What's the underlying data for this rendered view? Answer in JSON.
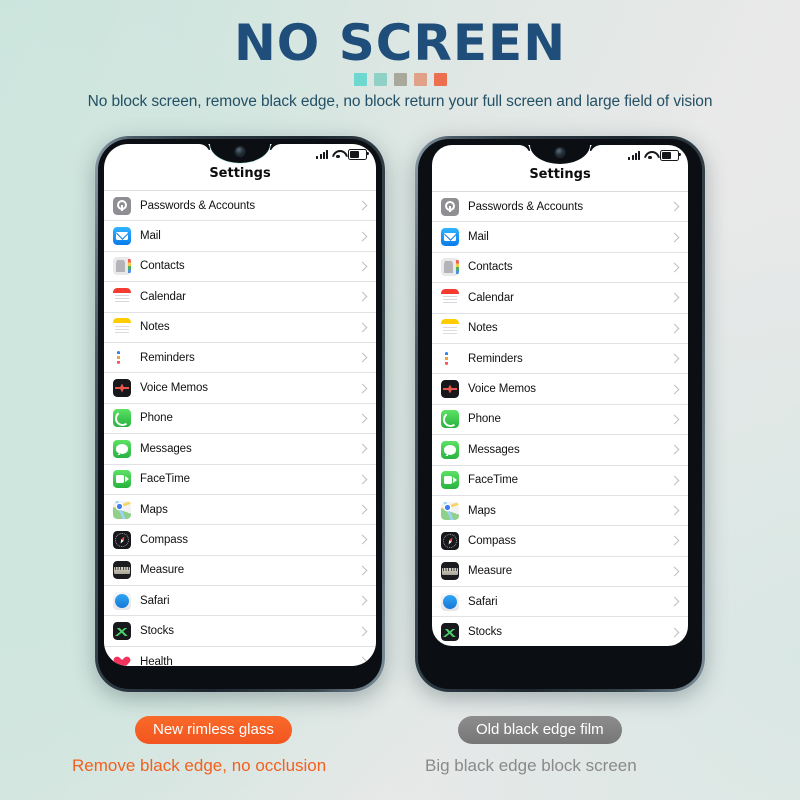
{
  "header": {
    "headline": "NO SCREEN",
    "subtitle": "No block screen, remove black edge, no block return your full screen and large field of vision",
    "headline_color": "#1e4e79",
    "subtitle_color": "#245066",
    "dots": [
      {
        "name": "dot-1",
        "color": "#6ed7cf"
      },
      {
        "name": "dot-2",
        "color": "#8fd1c4"
      },
      {
        "name": "dot-3",
        "color": "#a8a99b"
      },
      {
        "name": "dot-4",
        "color": "#e2a088"
      },
      {
        "name": "dot-5",
        "color": "#ec7050"
      }
    ]
  },
  "phones": [
    {
      "id": "left",
      "variant": "rimless",
      "statusbar": {
        "signal_icon": "signal-bars-icon",
        "wifi_icon": "wifi-icon",
        "battery_icon": "battery-icon"
      },
      "title": "Settings",
      "notch": "water-drop-notch",
      "camera": "front-camera"
    },
    {
      "id": "right",
      "variant": "black-edge",
      "statusbar": {
        "signal_icon": "signal-bars-icon",
        "wifi_icon": "wifi-icon",
        "battery_icon": "battery-icon"
      },
      "title": "Settings",
      "notch": "water-drop-notch",
      "camera": "front-camera"
    }
  ],
  "settings_list": [
    {
      "label": "Passwords & Accounts",
      "icon": "passwords-icon",
      "icon_class": "ic-passwords"
    },
    {
      "label": "Mail",
      "icon": "mail-icon",
      "icon_class": "ic-mail"
    },
    {
      "label": "Contacts",
      "icon": "contacts-icon",
      "icon_class": "ic-contacts"
    },
    {
      "label": "Calendar",
      "icon": "calendar-icon",
      "icon_class": "ic-calendar"
    },
    {
      "label": "Notes",
      "icon": "notes-icon",
      "icon_class": "ic-notes"
    },
    {
      "label": "Reminders",
      "icon": "reminders-icon",
      "icon_class": "ic-reminders"
    },
    {
      "label": "Voice Memos",
      "icon": "voice-memos-icon",
      "icon_class": "ic-voicememos"
    },
    {
      "label": "Phone",
      "icon": "phone-icon",
      "icon_class": "ic-phone"
    },
    {
      "label": "Messages",
      "icon": "messages-icon",
      "icon_class": "ic-messages"
    },
    {
      "label": "FaceTime",
      "icon": "facetime-icon",
      "icon_class": "ic-facetime"
    },
    {
      "label": "Maps",
      "icon": "maps-icon",
      "icon_class": "ic-maps"
    },
    {
      "label": "Compass",
      "icon": "compass-icon",
      "icon_class": "ic-compass"
    },
    {
      "label": "Measure",
      "icon": "measure-icon",
      "icon_class": "ic-measure"
    },
    {
      "label": "Safari",
      "icon": "safari-icon",
      "icon_class": "ic-safari"
    },
    {
      "label": "Stocks",
      "icon": "stocks-icon",
      "icon_class": "ic-stocks"
    },
    {
      "label": "Health",
      "icon": "health-icon",
      "icon_class": "ic-health"
    }
  ],
  "footer": {
    "new_badge": "New rimless glass",
    "new_caption": "Remove black edge, no occlusion",
    "old_badge": "Old black edge film",
    "old_caption": "Big black edge block screen",
    "new_color": "#f2601f",
    "old_color": "#8a8a8a"
  }
}
